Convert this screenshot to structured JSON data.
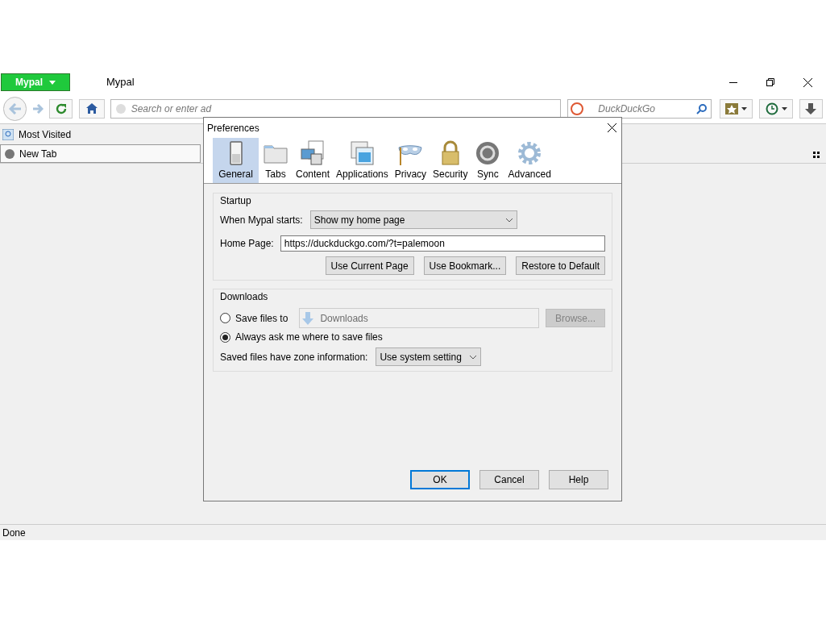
{
  "app_menu": {
    "label": "Mypal"
  },
  "window": {
    "title": "Mypal"
  },
  "toolbar": {
    "address": {
      "placeholder": "Search or enter ad"
    },
    "search": {
      "placeholder": "DuckDuckGo"
    }
  },
  "bookmarks_bar": {
    "items": [
      {
        "label": "Most Visited"
      }
    ]
  },
  "tabs": [
    {
      "label": "New Tab",
      "selected": true
    }
  ],
  "status_bar": {
    "text": "Done"
  },
  "dialog": {
    "title": "Preferences",
    "panes": [
      {
        "label": "General",
        "selected": true
      },
      {
        "label": "Tabs",
        "selected": false
      },
      {
        "label": "Content",
        "selected": false
      },
      {
        "label": "Applications",
        "selected": false
      },
      {
        "label": "Privacy",
        "selected": false
      },
      {
        "label": "Security",
        "selected": false
      },
      {
        "label": "Sync",
        "selected": false
      },
      {
        "label": "Advanced",
        "selected": false
      }
    ],
    "startup": {
      "legend": "Startup",
      "starts_label": "When Mypal starts:",
      "starts_value": "Show my home page",
      "home_label": "Home Page:",
      "home_value": "https://duckduckgo.com/?t=palemoon",
      "buttons": [
        "Use Current Page",
        "Use Bookmark...",
        "Restore to Default"
      ]
    },
    "downloads": {
      "legend": "Downloads",
      "options": [
        {
          "label": "Save files to",
          "selected": false
        },
        {
          "label": "Always ask me where to save files",
          "selected": true
        }
      ],
      "folder": {
        "value": "Downloads",
        "disabled": true
      },
      "browse": {
        "label": "Browse...",
        "disabled": true
      },
      "zone_label": "Saved files have zone information:",
      "zone_value": "Use system setting"
    },
    "buttons": [
      {
        "label": "OK",
        "default": true
      },
      {
        "label": "Cancel",
        "default": false
      },
      {
        "label": "Help",
        "default": false
      }
    ]
  }
}
